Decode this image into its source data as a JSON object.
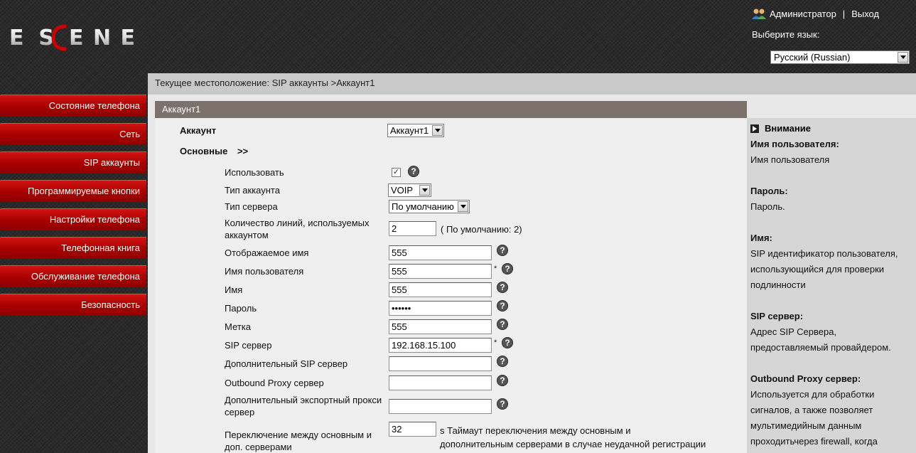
{
  "header": {
    "logo_text": "ESCENE",
    "user_label": "Администратор",
    "separator": "|",
    "logout_label": "Выход",
    "lang_label": "Выберите язык:",
    "lang_value": "Русский (Russian)"
  },
  "breadcrumb": "Текущее местоположение: SIP аккаунты >Аккаунт1",
  "sidebar": {
    "items": [
      {
        "label": "Состояние телефона"
      },
      {
        "label": "Сеть"
      },
      {
        "label": "SIP аккаунты"
      },
      {
        "label": "Программируемые кнопки"
      },
      {
        "label": "Настройки телефона"
      },
      {
        "label": "Телефонная книга"
      },
      {
        "label": "Обслуживание телефона"
      },
      {
        "label": "Безопасность"
      }
    ]
  },
  "section": {
    "title": "Аккаунт1",
    "account_label": "Аккаунт",
    "account_value": "Аккаунт1",
    "basic_label": "Основные",
    "basic_arrow": ">>"
  },
  "form": {
    "enable_label": "Использовать",
    "enable_checked": true,
    "account_type_label": "Тип аккаунта",
    "account_type_value": "VOIP",
    "server_type_label": "Тип сервера",
    "server_type_value": "По умолчанию",
    "lines_label_1": "Количество линий, используемых",
    "lines_label_2": "аккаунтом",
    "lines_value": "2",
    "lines_hint": "( По умолчанию: 2)",
    "display_name_label": "Отображаемое имя",
    "display_name_value": "555",
    "username_label": "Имя пользователя",
    "username_value": "555",
    "name_label": "Имя",
    "name_value": "555",
    "password_label": "Пароль",
    "password_value": "••••••",
    "tag_label": "Метка",
    "tag_value": "555",
    "sip_server_label": "SIP сервер",
    "sip_server_value": "192.168.15.100",
    "alt_sip_label": "Дополнительный SIP сервер",
    "alt_sip_value": "",
    "proxy_label": "Outbound Proxy сервер",
    "proxy_value": "",
    "alt_proxy_label_1": "Дополнительный экспортный прокси",
    "alt_proxy_label_2": "сервер",
    "alt_proxy_value": "",
    "switch_label_1": "Переключение между основным и",
    "switch_label_2": "доп. серверами",
    "switch_value": "32",
    "switch_hint_1": "s Таймаут переключения между основным и",
    "switch_hint_2": "дополнительным серверами в случае неудачной регистрации",
    "required_mark": "*",
    "help_mark": "?",
    "check_mark": "✓"
  },
  "help_panel": {
    "title": "Внимание",
    "items": [
      {
        "heading": "Имя пользователя:",
        "text": "Имя пользователя"
      },
      {
        "heading": "Пароль:",
        "text": "Пароль."
      },
      {
        "heading": "Имя:",
        "text": "SIP идентификатор пользователя, использующийся для проверки подлинности"
      },
      {
        "heading": "SIP сервер:",
        "text": "Адрес SIP Сервера, предоставляемый провайдером."
      },
      {
        "heading": "Outbound Proxy сервер:",
        "text": "Используется для обработки сигналов, а также позволяет мультимедийным данным проходитьчерез firewall, когда"
      }
    ]
  }
}
